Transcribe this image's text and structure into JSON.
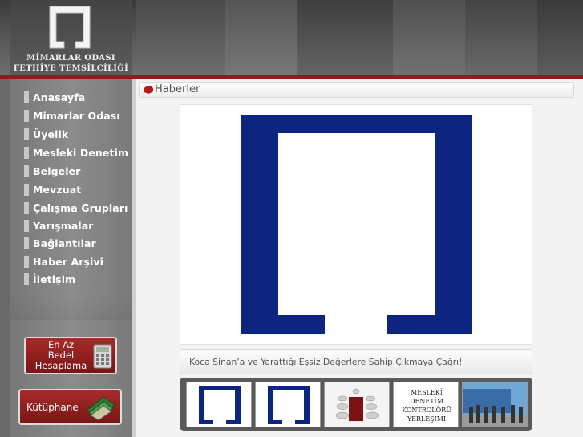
{
  "logo": {
    "line1": "MİMARLAR ODASI",
    "line2": "FETHİYE TEMSİLCİLİĞİ",
    "mark_icon": "bracket-logo-icon"
  },
  "sidebar": {
    "items": [
      {
        "label": "Anasayfa"
      },
      {
        "label": "Mimarlar Odası"
      },
      {
        "label": "Üyelik"
      },
      {
        "label": "Mesleki Denetim"
      },
      {
        "label": "Belgeler"
      },
      {
        "label": "Mevzuat"
      },
      {
        "label": "Çalışma Grupları"
      },
      {
        "label": "Yarışmalar"
      },
      {
        "label": "Bağlantılar"
      },
      {
        "label": "Haber Arşivi"
      },
      {
        "label": "İletişim"
      }
    ],
    "calc_button": {
      "line1": "En Az",
      "line2": "Bedel",
      "line3": "Hesaplama",
      "icon": "calculator-icon"
    },
    "library_button": {
      "label": "Kütüphane",
      "icon": "books-icon"
    }
  },
  "main": {
    "section_title": "Haberler",
    "section_icon": "tag-icon",
    "caption": "Koca Sinan’a ve Yarattığı Eşsiz Değerlere Sahip Çıkmaya Çağrı!",
    "thumbnails": [
      {
        "icon": "logo-thumbnail"
      },
      {
        "icon": "logo-thumbnail"
      },
      {
        "icon": "meeting-table-thumbnail"
      },
      {
        "text": "MESLEKİ DENETİM KONTROLÖRÜ YERLEŞİMİ"
      },
      {
        "icon": "group-photo-thumbnail"
      }
    ]
  },
  "colors": {
    "brand_red": "#8c1d1d",
    "logo_blue": "#0c2580",
    "sidebar_gray": "#888888"
  }
}
